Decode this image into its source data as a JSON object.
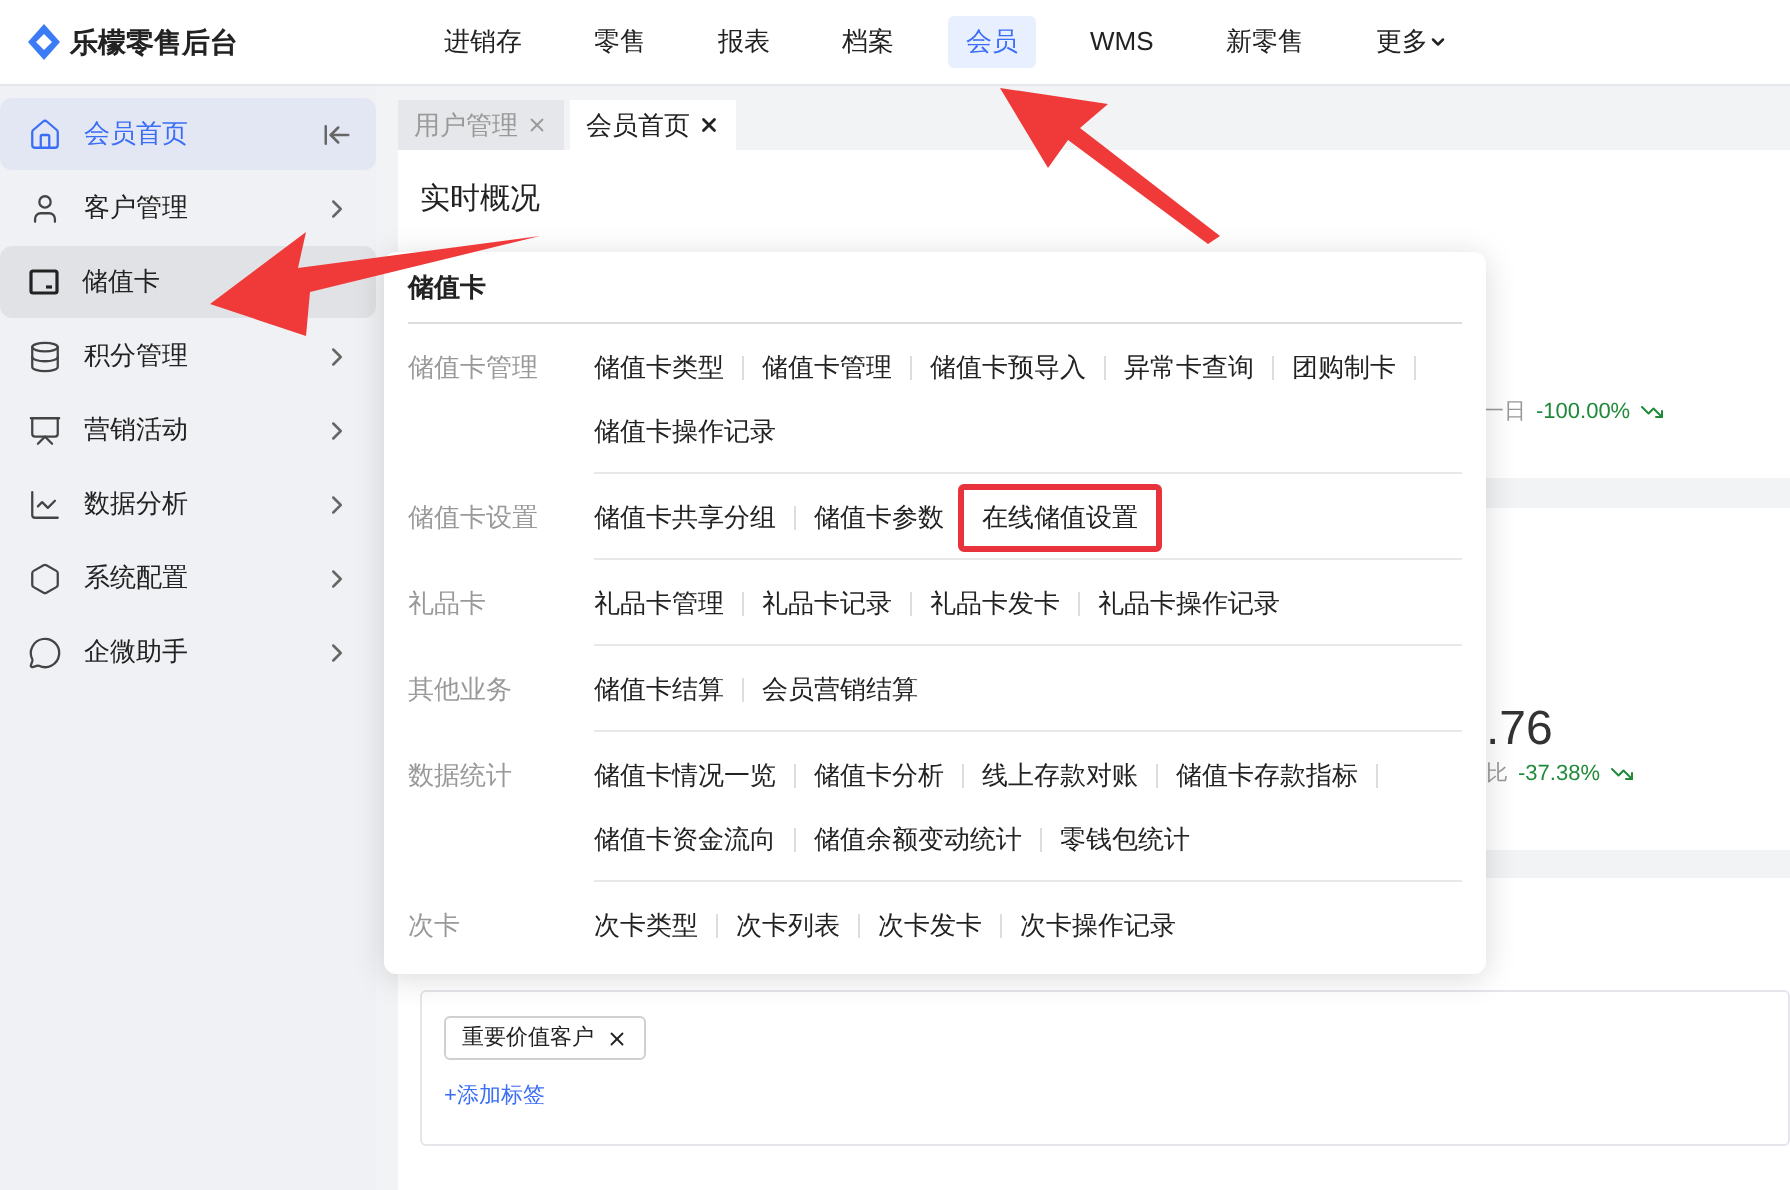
{
  "app": {
    "name": "乐檬零售后台"
  },
  "nav": [
    {
      "label": "进销存",
      "selected": false,
      "dropdown": false
    },
    {
      "label": "零售",
      "selected": false,
      "dropdown": false
    },
    {
      "label": "报表",
      "selected": false,
      "dropdown": false
    },
    {
      "label": "档案",
      "selected": false,
      "dropdown": false
    },
    {
      "label": "会员",
      "selected": true,
      "dropdown": false
    },
    {
      "label": "WMS",
      "selected": false,
      "dropdown": false
    },
    {
      "label": "新零售",
      "selected": false,
      "dropdown": false
    },
    {
      "label": "更多",
      "selected": false,
      "dropdown": true
    }
  ],
  "sidebar": {
    "items": [
      {
        "label": "会员首页",
        "selected": true,
        "hovered": false,
        "expandable": false
      },
      {
        "label": "客户管理",
        "selected": false,
        "hovered": false,
        "expandable": true
      },
      {
        "label": "储值卡",
        "selected": false,
        "hovered": true,
        "expandable": false
      },
      {
        "label": "积分管理",
        "selected": false,
        "hovered": false,
        "expandable": true
      },
      {
        "label": "营销活动",
        "selected": false,
        "hovered": false,
        "expandable": true
      },
      {
        "label": "数据分析",
        "selected": false,
        "hovered": false,
        "expandable": true
      },
      {
        "label": "系统配置",
        "selected": false,
        "hovered": false,
        "expandable": true
      },
      {
        "label": "企微助手",
        "selected": false,
        "hovered": false,
        "expandable": true
      }
    ]
  },
  "tabs": [
    {
      "label": "用户管理",
      "selected": false
    },
    {
      "label": "会员首页",
      "selected": true
    }
  ],
  "overview": {
    "title": "实时概况",
    "stat_1": {
      "label": "一日",
      "change": "-100.00%"
    },
    "stat_2": {
      "value": ".76",
      "label": "比",
      "change": "-37.38%"
    }
  },
  "tags": {
    "items": [
      "重要价值客户"
    ],
    "add": "+添加标签"
  },
  "menu": {
    "title": "储值卡",
    "groups": [
      {
        "label": "储值卡管理",
        "items": [
          {
            "label": "储值卡类型",
            "highlighted": false
          },
          {
            "label": "储值卡管理",
            "highlighted": false
          },
          {
            "label": "储值卡预导入",
            "highlighted": false
          },
          {
            "label": "异常卡查询",
            "highlighted": false
          },
          {
            "label": "团购制卡",
            "highlighted": false
          },
          {
            "label": "储值卡操作记录",
            "highlighted": false
          }
        ]
      },
      {
        "label": "储值卡设置",
        "items": [
          {
            "label": "储值卡共享分组",
            "highlighted": false
          },
          {
            "label": "储值卡参数",
            "highlighted": false
          },
          {
            "label": "在线储值设置",
            "highlighted": true
          }
        ]
      },
      {
        "label": "礼品卡",
        "items": [
          {
            "label": "礼品卡管理",
            "highlighted": false
          },
          {
            "label": "礼品卡记录",
            "highlighted": false
          },
          {
            "label": "礼品卡发卡",
            "highlighted": false
          },
          {
            "label": "礼品卡操作记录",
            "highlighted": false
          }
        ]
      },
      {
        "label": "其他业务",
        "items": [
          {
            "label": "储值卡结算",
            "highlighted": false
          },
          {
            "label": "会员营销结算",
            "highlighted": false
          }
        ]
      },
      {
        "label": "数据统计",
        "items": [
          {
            "label": "储值卡情况一览",
            "highlighted": false
          },
          {
            "label": "储值卡分析",
            "highlighted": false
          },
          {
            "label": "线上存款对账",
            "highlighted": false
          },
          {
            "label": "储值卡存款指标",
            "highlighted": false
          },
          {
            "label": "储值卡资金流向",
            "highlighted": false
          },
          {
            "label": "储值余额变动统计",
            "highlighted": false
          },
          {
            "label": "零钱包统计",
            "highlighted": false
          }
        ]
      },
      {
        "label": "次卡",
        "items": [
          {
            "label": "次卡类型",
            "highlighted": false
          },
          {
            "label": "次卡列表",
            "highlighted": false
          },
          {
            "label": "次卡发卡",
            "highlighted": false
          },
          {
            "label": "次卡操作记录",
            "highlighted": false
          }
        ]
      }
    ]
  }
}
